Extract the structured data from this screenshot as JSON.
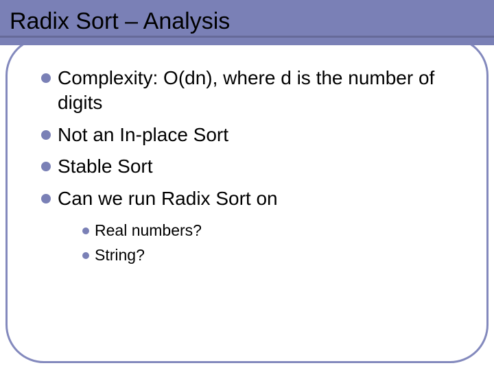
{
  "title": "Radix Sort – Analysis",
  "bullets_l1": [
    "Complexity: O(dn), where d is the number of digits",
    "Not an In-place Sort",
    "Stable Sort",
    "Can we run Radix Sort on"
  ],
  "bullets_l2": [
    "Real numbers?",
    "String?"
  ]
}
